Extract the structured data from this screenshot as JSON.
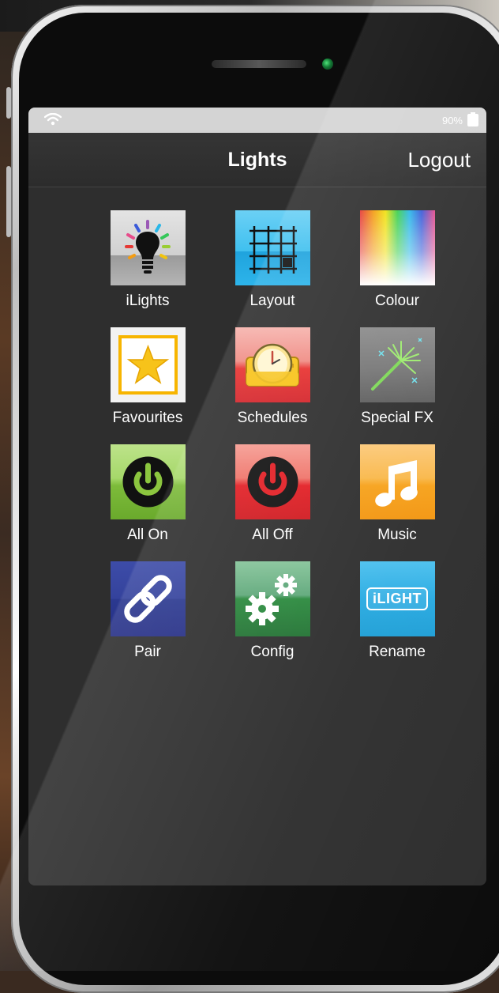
{
  "status_bar": {
    "battery_text": "90%",
    "wifi_icon": "wifi-icon",
    "battery_icon": "battery-icon"
  },
  "nav": {
    "title": "Lights",
    "logout_label": "Logout"
  },
  "tiles": [
    {
      "label": "iLights",
      "icon": "lightbulb-icon"
    },
    {
      "label": "Layout",
      "icon": "grid-layout-icon"
    },
    {
      "label": "Colour",
      "icon": "colour-spectrum-icon"
    },
    {
      "label": "Favourites",
      "icon": "star-icon"
    },
    {
      "label": "Schedules",
      "icon": "clock-icon"
    },
    {
      "label": "Special FX",
      "icon": "sparkle-wand-icon"
    },
    {
      "label": "All On",
      "icon": "power-on-icon"
    },
    {
      "label": "All Off",
      "icon": "power-off-icon"
    },
    {
      "label": "Music",
      "icon": "music-note-icon"
    },
    {
      "label": "Pair",
      "icon": "link-icon"
    },
    {
      "label": "Config",
      "icon": "gears-icon"
    },
    {
      "label": "Rename",
      "icon": "ilight-logo-icon",
      "logo_text": "iLIGHT"
    }
  ],
  "colors": {
    "screen_bg": "#2e2e2e",
    "layout_blue": "#2db4ea",
    "schedules_red": "#e8312f",
    "all_on_green": "#8cc63f",
    "all_off_red": "#e31e24",
    "music_orange": "#f7a21b",
    "pair_blue": "#2b3990",
    "config_green": "#2b8a3e",
    "rename_blue": "#29abe2"
  }
}
